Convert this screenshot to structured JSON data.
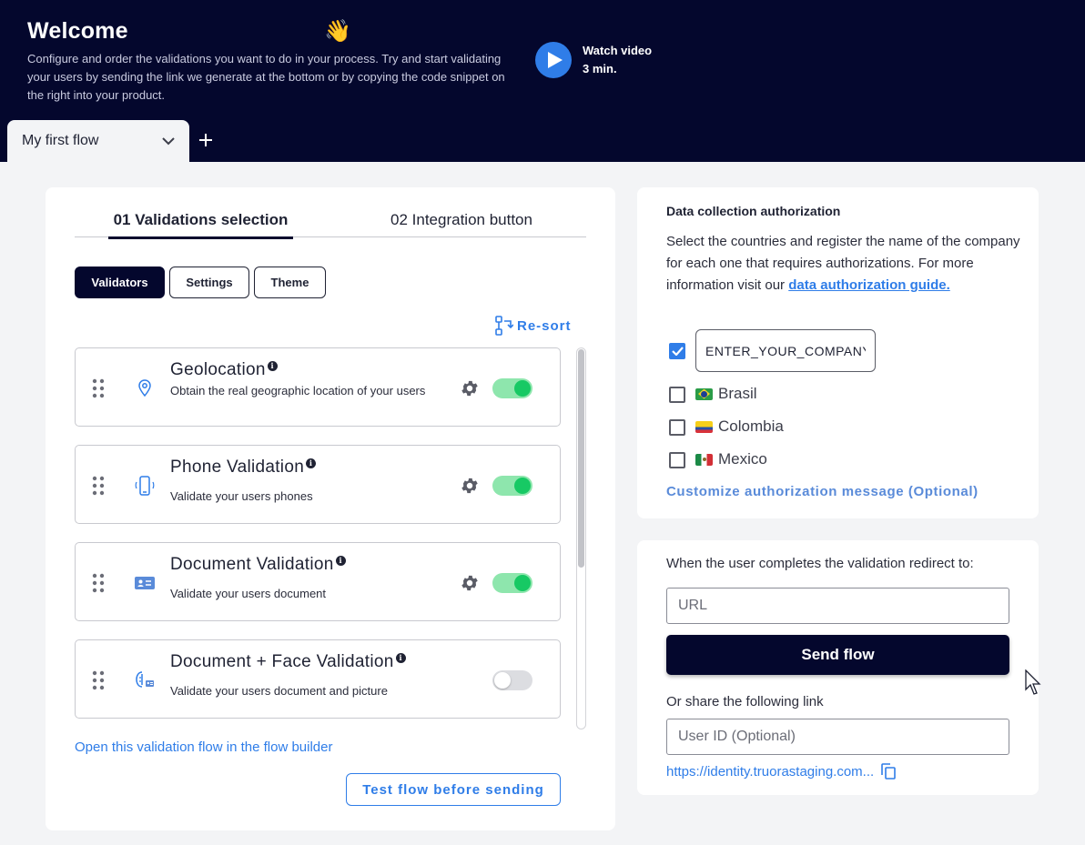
{
  "header": {
    "title": "Welcome",
    "wave_emoji": "👋",
    "description": "Configure and order the validations you want to do in your process. Try and start validating your users by sending the link we generate at the bottom or by copying the code snippet on the right into your product.",
    "watch_video": {
      "label": "Watch video",
      "duration": "3 min."
    }
  },
  "flow_tabs": [
    {
      "label": "My first flow"
    }
  ],
  "main_tabs": [
    {
      "label": "01 Validations selection",
      "active": true
    },
    {
      "label": "02 Integration button",
      "active": false
    }
  ],
  "sub_tabs": [
    {
      "label": "Validators",
      "active": true
    },
    {
      "label": "Settings",
      "active": false
    },
    {
      "label": "Theme",
      "active": false
    }
  ],
  "resort_label": "Re-sort",
  "validators": [
    {
      "title": "Geolocation",
      "description": "Obtain the real geographic location of your users",
      "enabled": true,
      "has_settings": true,
      "icon": "location-pin-icon"
    },
    {
      "title": "Phone Validation",
      "description": "Validate your users phones",
      "enabled": true,
      "has_settings": true,
      "icon": "phone-icon"
    },
    {
      "title": "Document Validation",
      "description": "Validate your users document",
      "enabled": true,
      "has_settings": true,
      "icon": "id-card-icon"
    },
    {
      "title": "Document + Face Validation",
      "description": "Validate your users document and picture",
      "enabled": false,
      "has_settings": false,
      "icon": "face-document-icon"
    }
  ],
  "builder_link": "Open this validation flow in the flow builder",
  "test_button": "Test flow before sending",
  "authorization": {
    "title": "Data collection authorization",
    "text": "Select the countries and register the name of the company for each one that requires authorizations. For more information visit our",
    "link": "data authorization guide.",
    "company_value": "ENTER_YOUR_COMPANY_",
    "countries": [
      {
        "name": "Brasil",
        "checked": false
      },
      {
        "name": "Colombia",
        "checked": false
      },
      {
        "name": "Mexico",
        "checked": false
      }
    ],
    "customize_link": "Customize authorization message (Optional)"
  },
  "redirect": {
    "label": "When the user completes the validation redirect to:",
    "url_placeholder": "URL",
    "send_button": "Send flow",
    "share_label": "Or share the following link",
    "user_id_placeholder": "User ID (Optional)",
    "share_link": "https://identity.truorastaging.com..."
  },
  "colors": {
    "header_bg": "#04072d",
    "accent": "#2f7de8",
    "toggle_on": "#17c964",
    "page_bg": "#f3f4f6"
  }
}
